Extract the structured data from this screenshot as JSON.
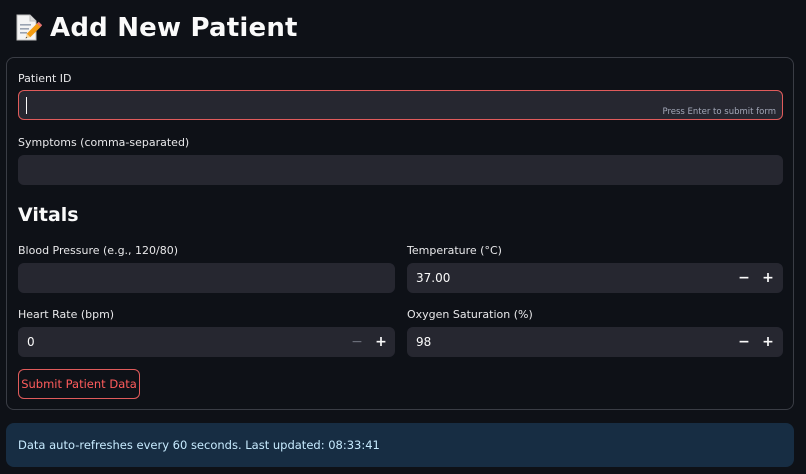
{
  "page": {
    "title": "Add New Patient",
    "title_icon": "memo-pencil-icon"
  },
  "form": {
    "patient_id": {
      "label": "Patient ID",
      "value": "",
      "hint": "Press Enter to submit form"
    },
    "symptoms": {
      "label": "Symptoms (comma-separated)",
      "value": ""
    },
    "vitals_heading": "Vitals",
    "blood_pressure": {
      "label": "Blood Pressure (e.g., 120/80)",
      "value": ""
    },
    "temperature": {
      "label": "Temperature (°C)",
      "value": "37.00"
    },
    "heart_rate": {
      "label": "Heart Rate (bpm)",
      "value": "0"
    },
    "oxygen_saturation": {
      "label": "Oxygen Saturation (%)",
      "value": "98"
    },
    "stepper": {
      "minus": "−",
      "plus": "+"
    },
    "submit_label": "Submit Patient Data"
  },
  "status": {
    "message": "Data auto-refreshes every 60 seconds. Last updated: 08:33:41"
  },
  "colors": {
    "background": "#0e1117",
    "field_bg": "#262730",
    "accent_red": "#ff4b4b",
    "info_bg": "#172d43"
  }
}
